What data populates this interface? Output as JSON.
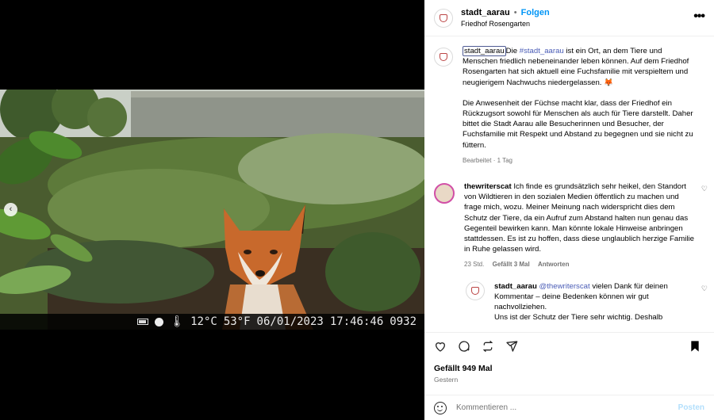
{
  "photo": {
    "osd": {
      "temp_c": "12°C",
      "temp_f": "53°F",
      "date": "06/01/2023",
      "time": "17:46:46",
      "frame": "0932"
    }
  },
  "header": {
    "username": "stadt_aarau",
    "separator": "•",
    "follow_label": "Folgen",
    "location": "Friedhof Rosengarten",
    "avatar_caption": "Aarau"
  },
  "caption": {
    "username": "stadt_aarau",
    "text_before": "Die ",
    "hashtag": "#stadt_aarau",
    "text_after": " ist ein Ort, an dem Tiere und Menschen friedlich nebeneinander leben können. Auf dem Friedhof Rosengarten hat sich aktuell eine Fuchsfamilie mit verspieltem und neugierigem Nachwuchs niedergelassen. 🦊",
    "paragraph2": "Die Anwesenheit der Füchse macht klar, dass der Friedhof ein Rückzugsort sowohl für Menschen als auch für Tiere darstellt. Daher bittet die Stadt Aarau alle Besucherinnen und Besucher, der Fuchsfamilie mit Respekt und Abstand zu begegnen und sie nicht zu füttern.",
    "meta": "Bearbeitet · 1 Tag"
  },
  "comment": {
    "username": "thewriterscat",
    "text": " Ich finde es grundsätzlich sehr heikel, den Standort von Wildtieren in den sozialen Medien öffentlich zu machen und frage mich, wozu. Meiner Meinung nach widerspricht dies dem Schutz der Tiere, da ein Aufruf zum Abstand halten nun genau das Gegenteil bewirken kann. Man könnte lokale Hinweise anbringen stattdessen. Es ist zu hoffen, dass diese unglaublich herzige Familie in Ruhe gelassen wird.",
    "time": "23 Std.",
    "likes": "Gefällt 3 Mal",
    "reply_label": "Antworten"
  },
  "reply": {
    "username": "stadt_aarau",
    "mention": "@thewriterscat",
    "text": " vielen Dank für deinen Kommentar – deine Bedenken können wir gut nachvollziehen.",
    "text2": "Uns ist der Schutz der Tiere sehr wichtig. Deshalb",
    "avatar_caption": "Aarau"
  },
  "footer": {
    "likes": "Gefällt 949 Mal",
    "date": "Gestern",
    "comment_placeholder": "Kommentieren ...",
    "post_label": "Posten"
  },
  "colors": {
    "accent": "#0095f6",
    "hashtag": "#4a5cb6",
    "muted": "#737373"
  }
}
